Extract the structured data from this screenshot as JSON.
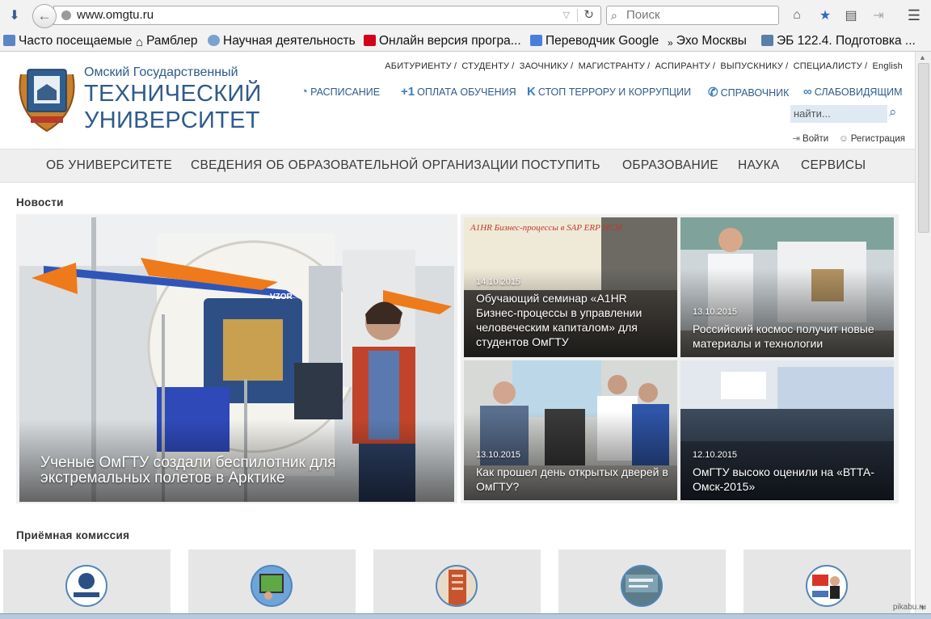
{
  "browser": {
    "url": "www.omgtu.ru",
    "search_placeholder": "Поиск",
    "bookmarks": [
      {
        "label": "Часто посещаемые"
      },
      {
        "label": "Рамблер"
      },
      {
        "label": "Научная деятельность"
      },
      {
        "label": "Онлайн версия програ..."
      },
      {
        "label": "Переводчик Google"
      },
      {
        "label": "Эхо Москвы"
      },
      {
        "label": "ЭБ 122.4. Подготовка ..."
      }
    ]
  },
  "header": {
    "logo_line1": "Омский Государственный",
    "logo_line2": "ТЕХНИЧЕСКИЙ",
    "logo_line3": "УНИВЕРСИТЕТ",
    "topnav": [
      "АБИТУРИЕНТУ",
      "СТУДЕНТУ",
      "ЗАОЧНИКУ",
      "МАГИСТРАНТУ",
      "АСПИРАНТУ",
      "ВЫПУСКНИКУ",
      "СПЕЦИАЛИСТУ",
      "English"
    ],
    "quicklinks": [
      {
        "label": "РАСПИСАНИЕ",
        "icon": "clock-icon"
      },
      {
        "label": "ОПЛАТА ОБУЧЕНИЯ",
        "icon": "plus-one-icon"
      },
      {
        "label": "СТОП ТЕРРОРУ И КОРРУПЦИИ",
        "icon": "k-icon"
      },
      {
        "label": "СПРАВОЧНИК",
        "icon": "phone-icon"
      },
      {
        "label": "СЛАБОВИДЯЩИМ",
        "icon": "glasses-icon"
      }
    ],
    "search_placeholder": "найти...",
    "login": "Войти",
    "register": "Регистрация"
  },
  "menu": [
    "ОБ УНИВЕРСИТЕТЕ",
    "СВЕДЕНИЯ ОБ ОБРАЗОВАТЕЛЬНОЙ ОРГАНИЗАЦИИ",
    "ПОСТУПИТЬ",
    "ОБРАЗОВАНИЕ",
    "НАУКА",
    "СЕРВИСЫ"
  ],
  "news": {
    "title": "Новости",
    "featured": {
      "caption_line1": "Ученые ОмГТУ создали беспилотник для",
      "caption_line2": "экстремальных полетов в Арктике",
      "drone_label": "VZOR"
    },
    "items": [
      {
        "date": "14.10.2015",
        "title": "Обучающий семинар «A1HR Бизнес-процессы в управлении человеческим капиталом» для студентов ОмГТУ",
        "slide_text": "A1HR Бизнес-процессы в SAP ERP HCM"
      },
      {
        "date": "13.10.2015",
        "title": "Российский космос получит новые материалы и технологии"
      },
      {
        "date": "13.10.2015",
        "title": "Как прошел день открытых дверей в ОмГТУ?"
      },
      {
        "date": "12.10.2015",
        "title": "ОмГТУ высоко оценили на «ВТТА-Омск-2015»"
      }
    ]
  },
  "admissions": {
    "title": "Приёмная комиссия",
    "cards": [
      {
        "icon": "physics-lyceum-icon"
      },
      {
        "icon": "tablet-icon"
      },
      {
        "icon": "building-icon"
      },
      {
        "icon": "sign-icon"
      },
      {
        "icon": "ege-icon"
      }
    ]
  },
  "watermark": "pikabu.ru"
}
